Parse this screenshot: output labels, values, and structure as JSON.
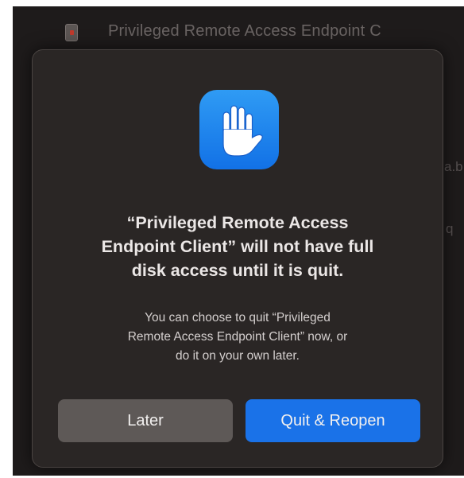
{
  "background": {
    "window_title": "Privileged Remote Access Endpoint C",
    "fragment_1": "a.b",
    "fragment_2": "q"
  },
  "dialog": {
    "icon": "hand-raised-icon",
    "headline_line1": "“Privileged Remote Access",
    "headline_line2": "Endpoint Client” will not have full",
    "headline_line3": "disk access until it is quit.",
    "body_line1": "You can choose to quit “Privileged",
    "body_line2": "Remote Access Endpoint Client” now, or",
    "body_line3": "do it on your own later.",
    "secondary_button": "Later",
    "primary_button": "Quit & Reopen"
  },
  "colors": {
    "accent": "#1a72e8",
    "icon_blue": "#2f9bf4",
    "dialog_bg": "#2a2625",
    "secondary_button_bg": "#5e5957"
  }
}
